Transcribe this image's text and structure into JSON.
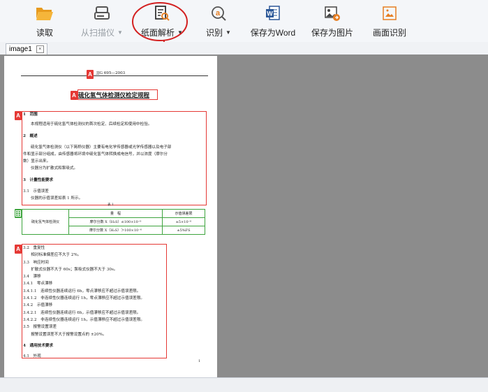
{
  "toolbar": {
    "buttons": [
      {
        "label": "读取"
      },
      {
        "label": "从扫描仪"
      },
      {
        "label": "纸面解析"
      },
      {
        "label": "识别"
      },
      {
        "label": "保存为Word"
      },
      {
        "label": "保存为图片"
      },
      {
        "label": "画面识别"
      }
    ]
  },
  "tabs": [
    {
      "label": "image1"
    }
  ],
  "document": {
    "code": "JJG 695—2003",
    "title": "硫化氢气体检测仪检定规程",
    "s1_heading": "1　范围",
    "s1_text": "本规程适用于硫化氢气体检测仪的首次检定、后续检定和使用中检验。",
    "s2_heading": "2　概述",
    "s2_text1": "硫化氢气体检测仪（以下简称仪器）主要有电化学传感器或光学传感器以及电子部",
    "s2_text2": "件和显示部分组成，由传感器将环境中硫化氢气体转换成电信号，并以浓度（摩尔分",
    "s2_text3": "数）显示出来。",
    "s2_text4": "仪器分为扩散式和泵吸式。",
    "s3_heading": "3　计量性能要求",
    "s31_heading": "3.1　示值误差",
    "s31_text": "仪器的示值误差如表 1 所示。",
    "table_caption": "表 1",
    "table": {
      "head_range": "量　程",
      "head_error": "示值误差限",
      "row_label": "硫化氢气体检测仪",
      "r1_range": "摩尔分数 X（H₂S）≤100×10⁻⁶",
      "r1_error": "±5×10⁻⁶",
      "r2_range": "摩尔分数 X（H₂S）＞100×10⁻⁶",
      "r2_error": "±5%FS"
    },
    "lines_b": [
      "3.2　重复性",
      "　　相对标准偏差应不大于 2%。",
      "3.3　响应时间",
      "　　扩散式仪器不大于 60s；泵吸式仪器不大于 30s。",
      "3.4　漂移",
      "3.4.1　零点漂移",
      "3.4.1.1　连续性仪器连续运行 6h，零点漂移应不超过示值误差限。",
      "3.4.1.2　非连续性仪器连续运行 1h，零点漂移应不超过示值误差限。",
      "3.4.2　示值漂移",
      "3.4.2.1　连续性仪器连续运行 6h，示值漂移应不超过示值误差限。",
      "3.4.2.2　非连续性仪器连续运行 1h，示值漂移应不超过示值误差限。",
      "3.5　报警设置误差",
      "　　报警设置误差不大于报警设置点的 ±20%。"
    ],
    "s4_heading": "4　通用技术要求",
    "s41_heading": "4.1　外观",
    "page_number": "1"
  },
  "badge_letter": "A",
  "colors": {
    "annotation_red": "#e53935",
    "annotation_green": "#3ea43e",
    "workspace_gray": "#8c8c8c"
  }
}
